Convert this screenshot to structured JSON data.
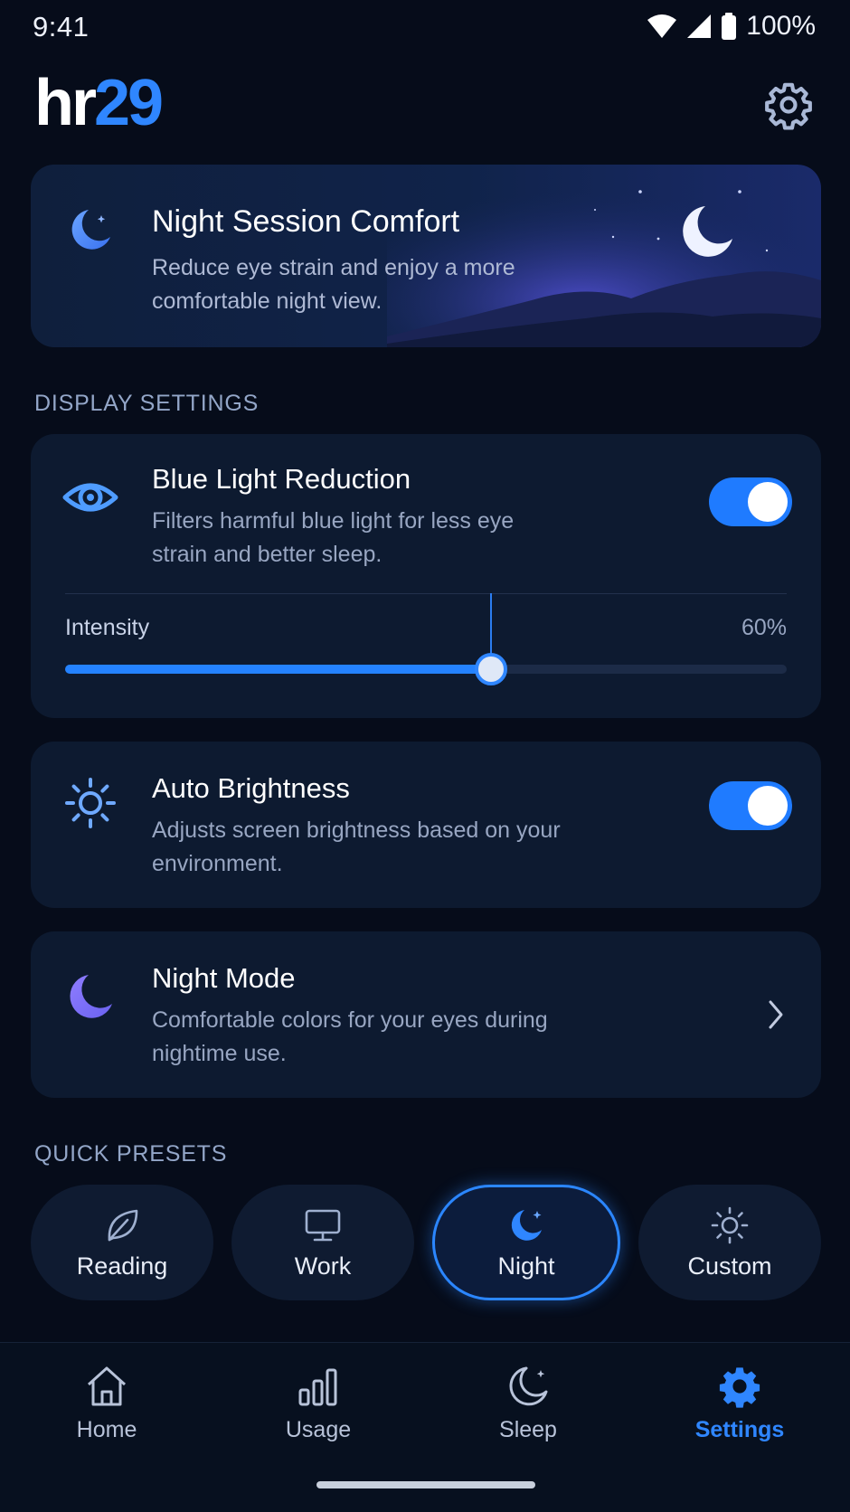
{
  "status_bar": {
    "time": "9:41",
    "battery": "100%"
  },
  "header": {
    "logo_part1": "hr",
    "logo_part2": "29"
  },
  "hero": {
    "title": "Night Session Comfort",
    "subtitle": "Reduce eye strain and enjoy a more comfortable night view."
  },
  "display_settings": {
    "label": "DISPLAY SETTINGS",
    "blue_light": {
      "title": "Blue Light Reduction",
      "subtitle": "Filters harmful blue light for less eye strain and better sleep.",
      "enabled": true,
      "intensity_label": "Intensity",
      "intensity_value": "60%",
      "intensity_fraction": 0.59
    },
    "auto_brightness": {
      "title": "Auto Brightness",
      "subtitle": "Adjusts screen brightness based on your environment.",
      "enabled": true
    },
    "night_mode": {
      "title": "Night Mode",
      "subtitle": "Comfortable colors for your eyes during nightime use."
    }
  },
  "quick_presets": {
    "label": "QUICK PRESETS",
    "items": [
      {
        "label": "Reading",
        "icon": "leaf-icon",
        "active": false
      },
      {
        "label": "Work",
        "icon": "monitor-icon",
        "active": false
      },
      {
        "label": "Night",
        "icon": "moon-star-icon",
        "active": true
      },
      {
        "label": "Custom",
        "icon": "sun-icon",
        "active": false
      }
    ]
  },
  "nav": {
    "items": [
      {
        "label": "Home",
        "icon": "home-icon"
      },
      {
        "label": "Usage",
        "icon": "bar-chart-icon"
      },
      {
        "label": "Sleep",
        "icon": "moon-icon"
      },
      {
        "label": "Settings",
        "icon": "gear-icon"
      }
    ],
    "active_index": 3
  },
  "colors": {
    "background": "#060c1a",
    "card": "#0d1a30",
    "accent": "#2f86ff",
    "text_secondary": "#98a6c2"
  }
}
